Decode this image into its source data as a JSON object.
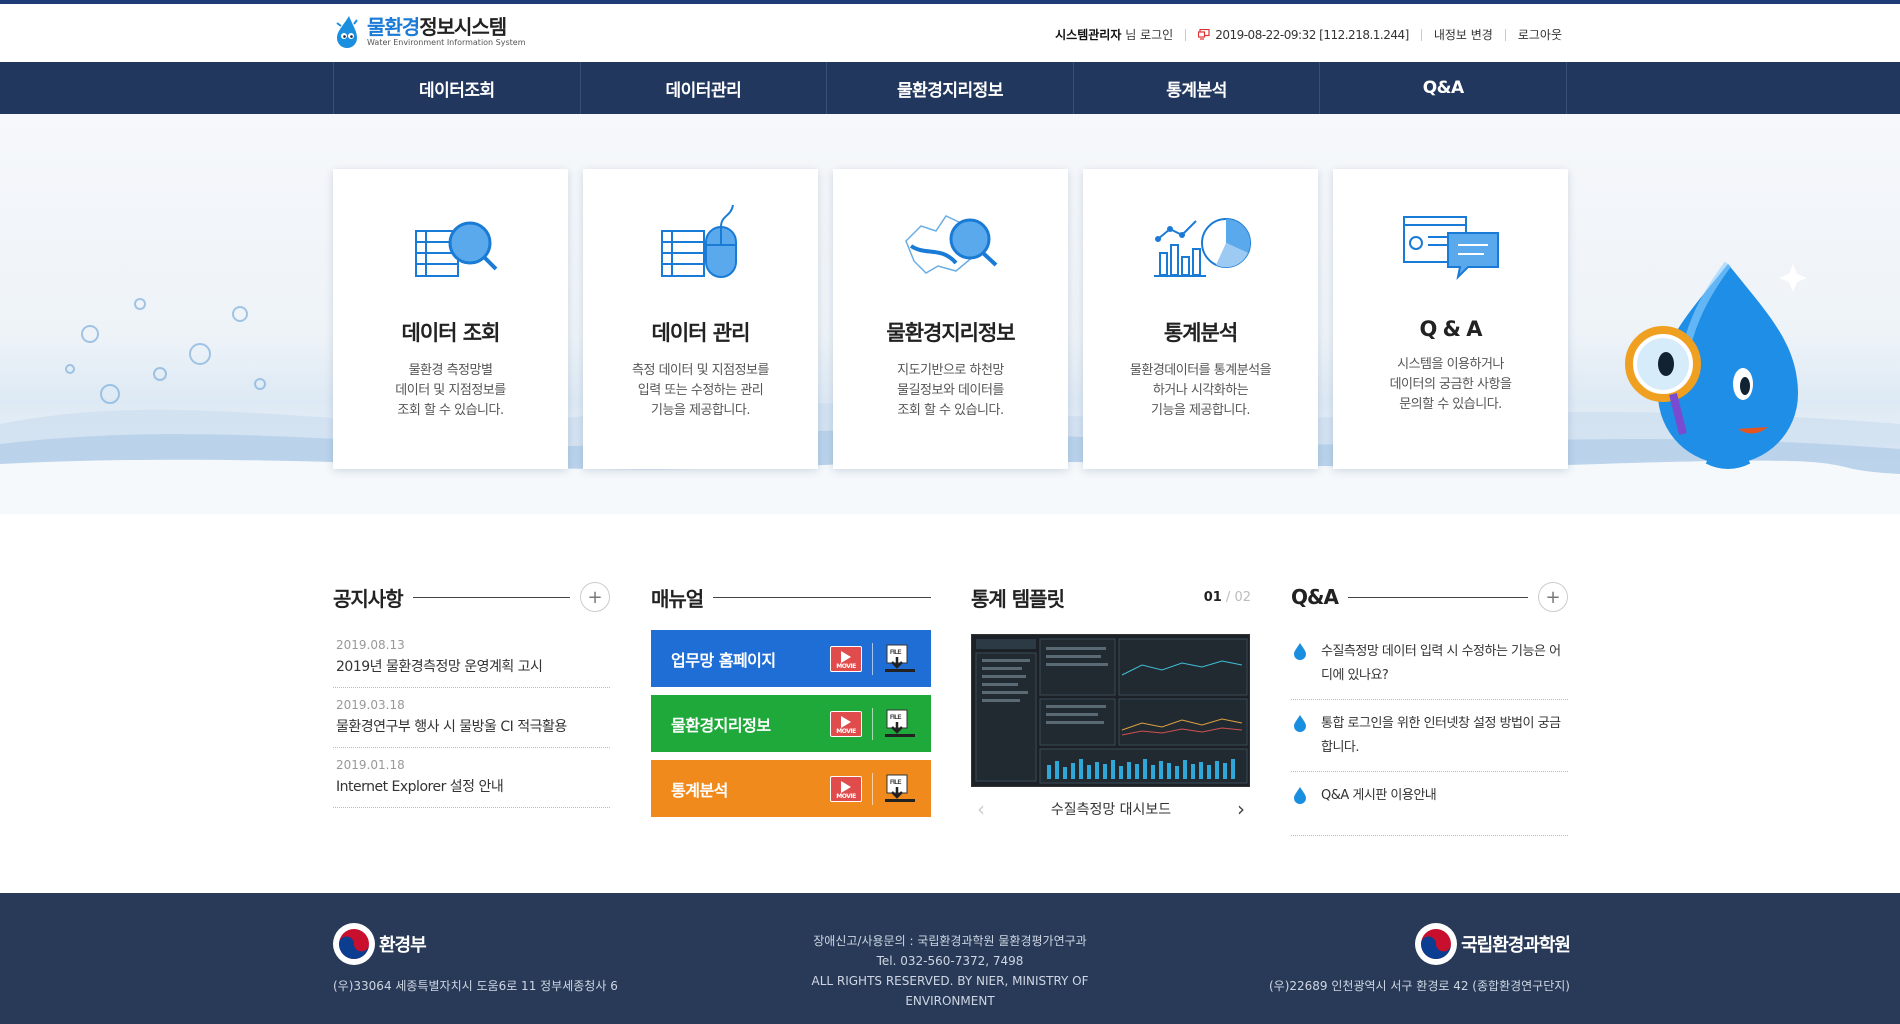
{
  "header": {
    "logo_title_highlight": "물환경",
    "logo_title_rest": "정보시스템",
    "logo_subtitle": "Water Environment Information System",
    "user_name": "시스템관리자",
    "user_suffix": "님 로그인",
    "last_access": "2019-08-22-09:32 [112.218.1.244]",
    "profile_link": "내정보 변경",
    "logout_link": "로그아웃"
  },
  "nav": {
    "items": [
      "데이터조회",
      "데이터관리",
      "물환경지리정보",
      "통계분석",
      "Q&A"
    ]
  },
  "cards": [
    {
      "title": "데이터 조회",
      "desc": "물환경 측정망별\n데이터 및 지점정보를\n조회 할 수 있습니다.",
      "icon": "data-search-icon"
    },
    {
      "title": "데이터 관리",
      "desc": "측정 데이터 및 지점정보를\n입력 또는 수정하는 관리\n기능을 제공합니다.",
      "icon": "data-manage-icon"
    },
    {
      "title": "물환경지리정보",
      "desc": "지도기반으로 하천망\n물길정보와 데이터를\n조회 할 수 있습니다.",
      "icon": "map-search-icon"
    },
    {
      "title": "통계분석",
      "desc": "물환경데이터를 통계분석을\n하거나 시각화하는\n기능을 제공합니다.",
      "icon": "chart-icon"
    },
    {
      "title": "Q & A",
      "desc": "시스템을 이용하거나\n데이터의 궁금한 사항을\n문의할 수 있습니다.",
      "icon": "chat-icon"
    }
  ],
  "notice": {
    "title": "공지사항",
    "more": "+",
    "items": [
      {
        "date": "2019.08.13",
        "title": "2019년 물환경측정망 운영계획 고시"
      },
      {
        "date": "2019.03.18",
        "title": "물환경연구부 행사 시 물방울 CI 적극활용"
      },
      {
        "date": "2019.01.18",
        "title": "Internet Explorer 설정 안내"
      }
    ]
  },
  "manual": {
    "title": "매뉴얼",
    "movie_label": "MOVIE",
    "file_label": "FILE",
    "items": [
      {
        "title": "업무망 홈페이지",
        "color": "#1f6ed6"
      },
      {
        "title": "물환경지리정보",
        "color": "#1fa93a"
      },
      {
        "title": "통계분석",
        "color": "#f08a1c"
      }
    ]
  },
  "stats": {
    "title": "통계 템플릿",
    "page_current": "01",
    "page_sep": "/",
    "page_total": "02",
    "caption": "수질측정망 대시보드",
    "prev": "‹",
    "next": "›"
  },
  "qna": {
    "title": "Q&A",
    "more": "+",
    "items": [
      "수질측정망 데이터 입력 시 수정하는 기능은 어디에 있나요?",
      "통합 로그인을 위한 인터넷창 설정 방법이 궁금합니다.",
      "Q&A 게시판 이용안내"
    ]
  },
  "footer": {
    "left_name": "환경부",
    "left_addr": "(우)33064 세종특별자치시 도움6로 11 정부세종청사 6",
    "center_line1": "장애신고/사용문의 : 국립환경과학원 물환경평가연구과",
    "center_line2": "Tel. 032-560-7372, 7498",
    "center_line3": "ALL RIGHTS RESERVED. BY NIER, MINISTRY OF ENVIRONMENT",
    "right_name": "국립환경과학원",
    "right_addr": "(우)22689 인천광역시 서구 환경로 42 (종합환경연구단지)"
  },
  "colors": {
    "nav_bg": "#22375e",
    "accent": "#1a7bd6",
    "footer_bg": "#283a58"
  }
}
